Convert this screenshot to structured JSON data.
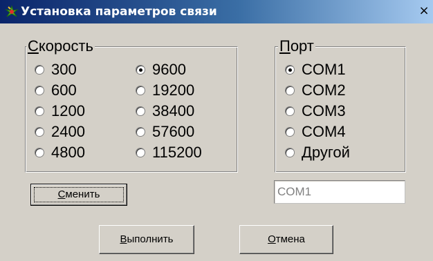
{
  "window": {
    "title": "Установка параметров связи",
    "close_glyph": "×"
  },
  "speed": {
    "legend": "Скорость",
    "options": [
      "300",
      "600",
      "1200",
      "2400",
      "4800",
      "9600",
      "19200",
      "38400",
      "57600",
      "115200"
    ],
    "selected": "9600"
  },
  "port": {
    "legend": "Порт",
    "options": [
      "COM1",
      "COM2",
      "COM3",
      "COM4",
      "Другой"
    ],
    "selected": "COM1",
    "custom_value": "COM1"
  },
  "buttons": {
    "change": "Сменить",
    "execute": "Выполнить",
    "cancel": "Отмена"
  },
  "colors": {
    "dialog_bg": "#d4d0c8",
    "titlebar_start": "#0a246a",
    "titlebar_end": "#a6caf0"
  },
  "icons": {
    "title": "app-icon"
  }
}
